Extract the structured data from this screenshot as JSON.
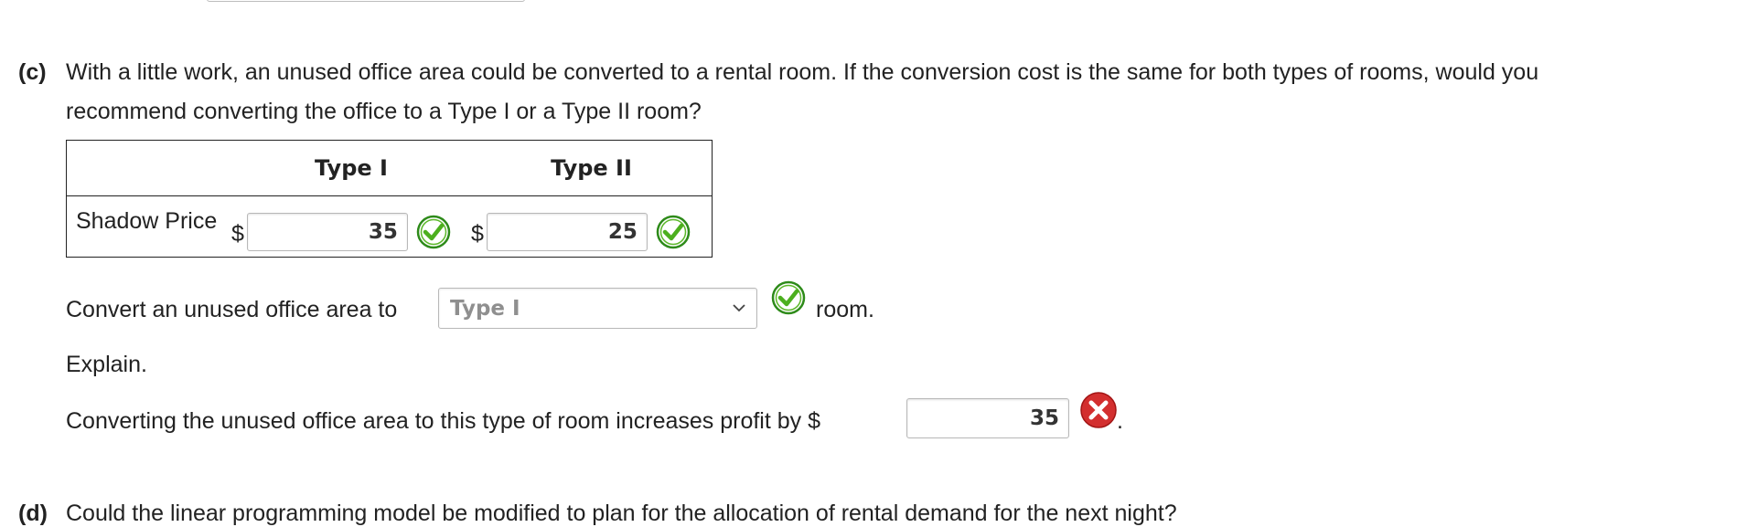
{
  "part_c": {
    "label": "(c)",
    "question_line1": "With a little work, an unused office area could be converted to a rental room. If the conversion cost is the same for both types of rooms, would you",
    "question_line2": "recommend converting the office to a Type I or a Type II room?"
  },
  "shadow_table": {
    "columns": [
      "",
      "Type I",
      "Type II"
    ],
    "rows": [
      {
        "label": "Shadow Price",
        "type1": {
          "currency": "$",
          "value": "35",
          "status": "correct"
        },
        "type2": {
          "currency": "$",
          "value": "25",
          "status": "correct"
        }
      }
    ]
  },
  "convert": {
    "prefix": "Convert an unused office area to",
    "selected": "Type I",
    "status": "correct",
    "suffix": "room."
  },
  "explain": {
    "label": "Explain."
  },
  "profit": {
    "text": "Converting the unused office area to this type of room increases profit by $",
    "value": "35",
    "status": "incorrect",
    "trailing": "."
  },
  "part_d": {
    "label": "(d)",
    "question": "Could the linear programming model be modified to plan for the allocation of rental demand for the next night?"
  },
  "colors": {
    "correct_green": "#4caf1e",
    "incorrect_red": "#d32f2f"
  },
  "icons": {
    "correct": "check-circle-icon",
    "incorrect": "x-circle-icon",
    "dropdown": "chevron-down-icon"
  }
}
